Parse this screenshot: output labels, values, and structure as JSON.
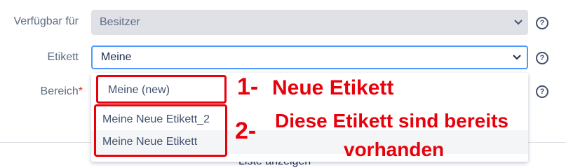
{
  "fields": {
    "available_for": {
      "label": "Verfügbar für",
      "value": "Besitzer"
    },
    "label_field": {
      "label": "Etikett",
      "value": "Meine"
    },
    "scope": {
      "label": "Bereich",
      "required_mark": "*"
    }
  },
  "help_glyph": "?",
  "dropdown": {
    "options": [
      "Meine (new)",
      "Meine Neue Etikett_2",
      "Meine Neue Etikett"
    ]
  },
  "annotations": {
    "one_num": "1-",
    "one_text": "Neue Etikett",
    "two_num": "2-",
    "two_text_line1": "Diese Etikett sind bereits",
    "two_text_line2": "vorhanden"
  },
  "bottom_partial_text": "Liste anzeigen",
  "colors": {
    "annotation_red": "#e8000b",
    "select_bg": "#dfe1e6",
    "focus_border": "#4c9aff"
  }
}
